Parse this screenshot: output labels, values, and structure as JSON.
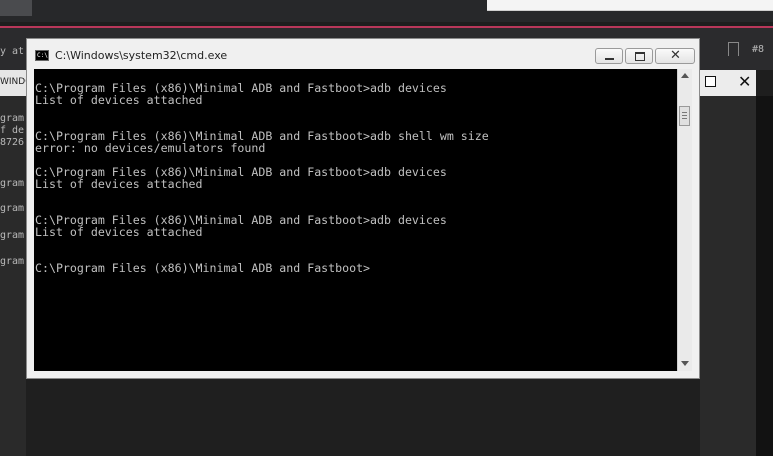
{
  "background": {
    "left_texts": [
      "y at",
      "gram",
      "f de",
      "8726",
      "gram",
      "gram",
      "gram",
      "gram"
    ],
    "left_windo": "WINDO",
    "right_hash": "#8"
  },
  "window": {
    "title": "C:\\Windows\\system32\\cmd.exe",
    "icon_label": "C:\\"
  },
  "console": {
    "lines": [
      "C:\\Program Files (x86)\\Minimal ADB and Fastboot>adb devices",
      "List of devices attached",
      "",
      "",
      "C:\\Program Files (x86)\\Minimal ADB and Fastboot>adb shell wm size",
      "error: no devices/emulators found",
      "",
      "C:\\Program Files (x86)\\Minimal ADB and Fastboot>adb devices",
      "List of devices attached",
      "",
      "",
      "C:\\Program Files (x86)\\Minimal ADB and Fastboot>adb devices",
      "List of devices attached",
      "",
      "",
      "C:\\Program Files (x86)\\Minimal ADB and Fastboot>"
    ]
  },
  "colors": {
    "console_bg": "#000000",
    "console_text": "#c0c0c0",
    "accent_line": "#b9375a"
  }
}
